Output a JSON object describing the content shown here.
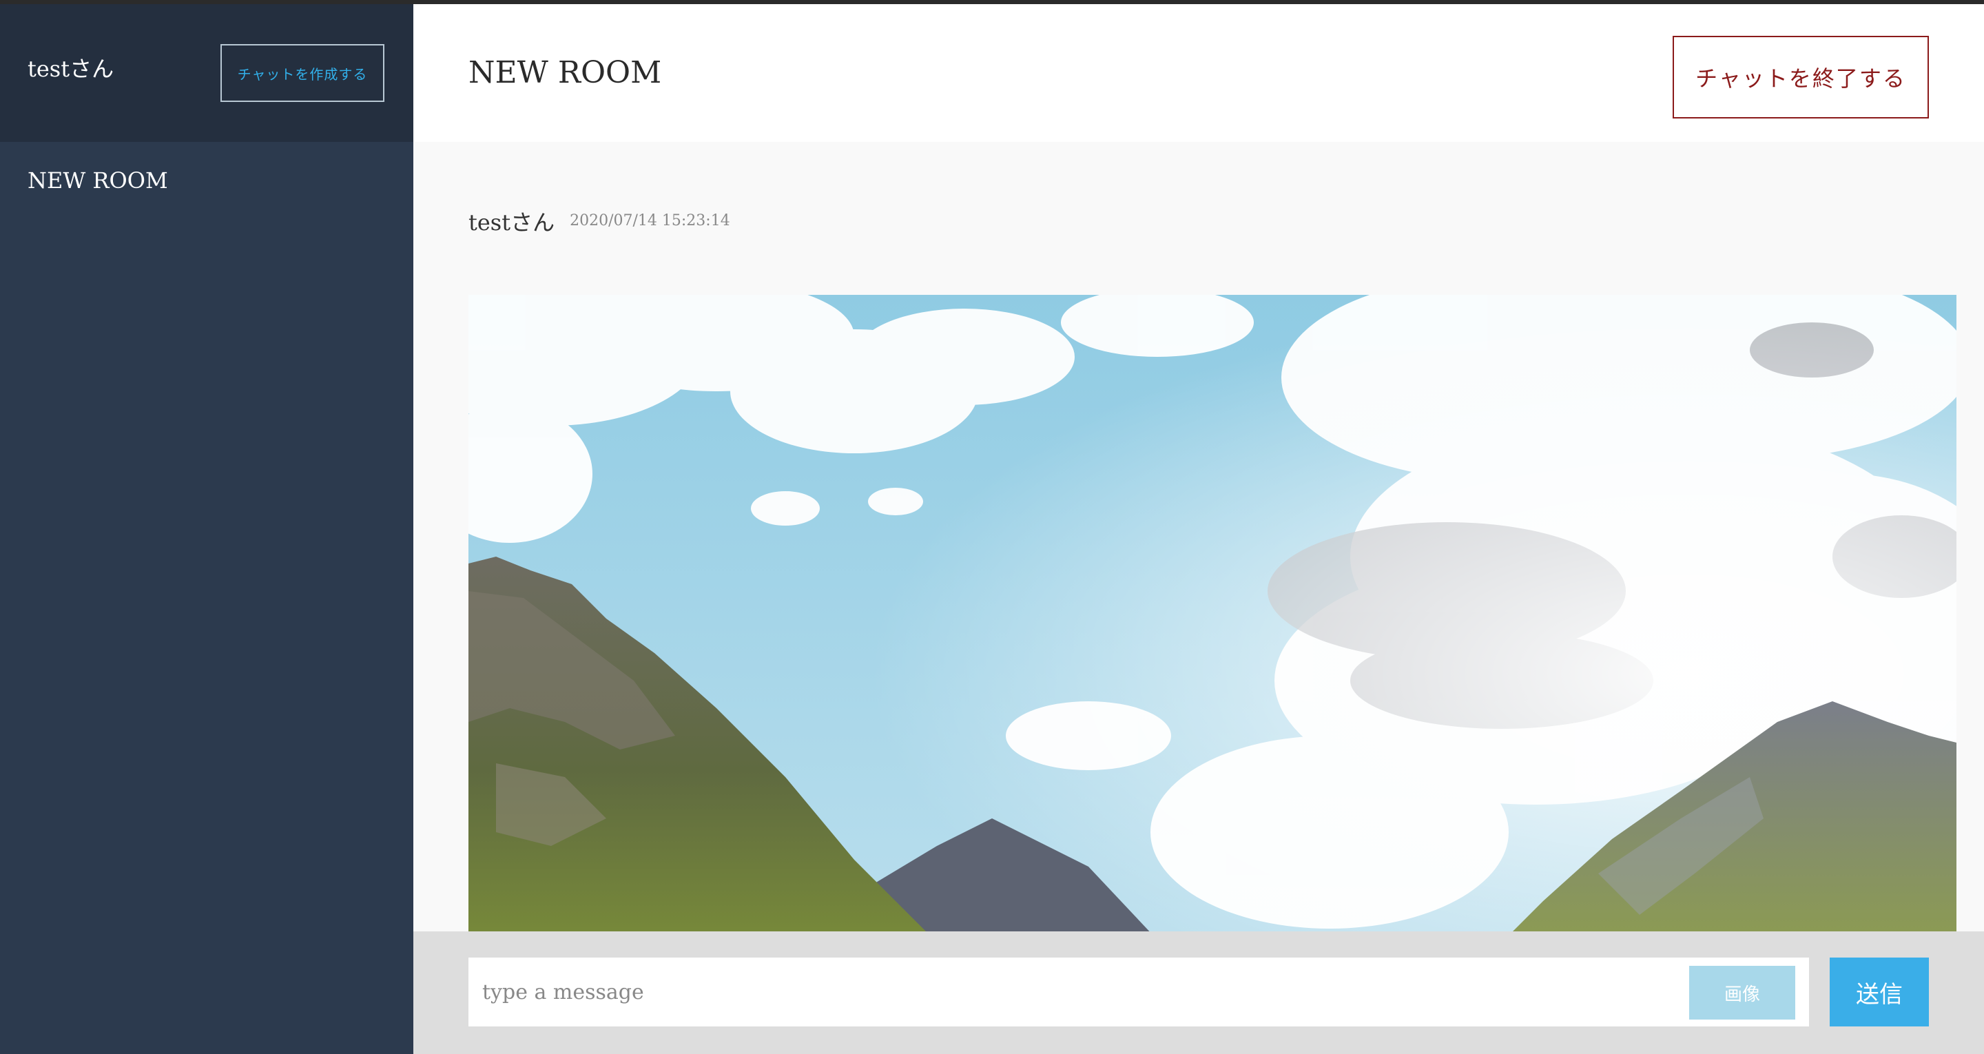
{
  "sidebar": {
    "user_name": "testさん",
    "create_chat_label": "チャットを作成する",
    "rooms": [
      {
        "label": "NEW ROOM"
      }
    ]
  },
  "header": {
    "room_title": "NEW ROOM",
    "end_chat_label": "チャットを終了する"
  },
  "messages": [
    {
      "author": "testさん",
      "timestamp": "2020/07/14 15:23:14",
      "image": "landscape-photo"
    }
  ],
  "composer": {
    "placeholder": "type a message",
    "value": "",
    "image_button_label": "画像",
    "send_button_label": "送信"
  },
  "colors": {
    "sidebar_bg": "#2c3a4e",
    "sidebar_header_bg": "#242f3f",
    "accent_blue": "#3aaee8",
    "end_chat_red": "#8b1a1a",
    "image_button_bg": "#a8d8ea"
  }
}
